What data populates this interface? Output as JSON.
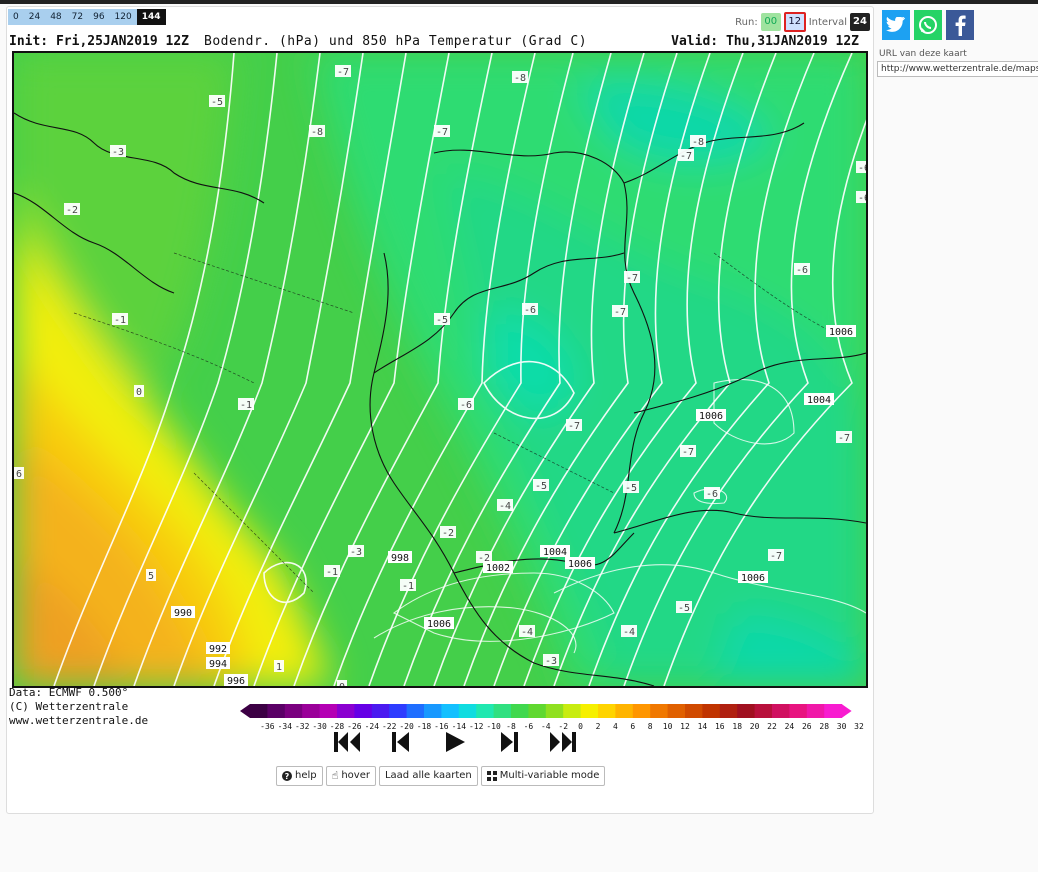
{
  "forecast_hours": [
    "0",
    "24",
    "48",
    "72",
    "96",
    "120",
    "144"
  ],
  "selected_hour": "144",
  "run": {
    "label": "Run:",
    "opt1": "00",
    "opt2": "12",
    "interval_label": "Interval",
    "interval_value": "24"
  },
  "map": {
    "init": "Init: Fri,25JAN2019 12Z",
    "center_title": "Bodendr. (hPa) und 850 hPa Temperatur (Grad C)",
    "valid": "Valid: Thu,31JAN2019 12Z",
    "temp_labels": [
      "-7",
      "-8",
      "-5",
      "-8",
      "-7",
      "-3",
      "-8",
      "-7",
      "-6",
      "-2",
      "-6",
      "-7",
      "-6",
      "-1",
      "-5",
      "-6",
      "-7",
      "0",
      "-1",
      "-6",
      "-7",
      "-7",
      "-4",
      "-5",
      "-5",
      "-6",
      "-7",
      "-3",
      "-2",
      "-2",
      "-1",
      "-7",
      "-4",
      "-4",
      "-3",
      "-5",
      "-1",
      "6",
      "5",
      "1",
      "0"
    ],
    "pressure_labels": [
      "1006",
      "1004",
      "1006",
      "998",
      "1002",
      "1004",
      "1006",
      "1006",
      "1006",
      "990",
      "992",
      "994",
      "996"
    ]
  },
  "data_info": {
    "line1": "Data: ECMWF  0.500°",
    "line2": "(C) Wetterzentrale",
    "line3": "www.wetterzentrale.de"
  },
  "scale_labels": [
    "-36",
    "-34",
    "-32",
    "-30",
    "-28",
    "-26",
    "-24",
    "-22",
    "-20",
    "-18",
    "-16",
    "-14",
    "-12",
    "-10",
    "-8",
    "-6",
    "-4",
    "-2",
    "0",
    "2",
    "4",
    "6",
    "8",
    "10",
    "12",
    "14",
    "16",
    "18",
    "20",
    "22",
    "24",
    "26",
    "28",
    "30",
    "32"
  ],
  "scale_colors": [
    "#3c0044",
    "#5a0066",
    "#7a007f",
    "#9a0099",
    "#b400b4",
    "#8a00d0",
    "#6600e6",
    "#4a1af0",
    "#2e3cff",
    "#1f6eff",
    "#1899ff",
    "#14c0ff",
    "#10dce0",
    "#20e8b0",
    "#30e080",
    "#40d84e",
    "#60d830",
    "#90e020",
    "#c8ec10",
    "#f6f000",
    "#ffd400",
    "#ffb400",
    "#ff9600",
    "#f07800",
    "#e06000",
    "#d04a00",
    "#c03400",
    "#b02010",
    "#a01020",
    "#b8103c",
    "#d01060",
    "#e81480",
    "#f018a8",
    "#f81cd0"
  ],
  "controls": {
    "first": "first",
    "prev": "previous",
    "play": "play",
    "next": "next",
    "last": "last"
  },
  "buttons": {
    "help": "help",
    "hover": "hover",
    "load_all": "Laad alle kaarten",
    "multivar": "Multi-variable mode"
  },
  "share": {
    "url_label": "URL van deze kaart",
    "url_value": "http://www.wetterzentrale.de/maps"
  },
  "colors": {
    "accent_red": "#dd2222",
    "twitter": "#1da1f2",
    "whatsapp": "#25d366",
    "facebook": "#3b5998"
  }
}
